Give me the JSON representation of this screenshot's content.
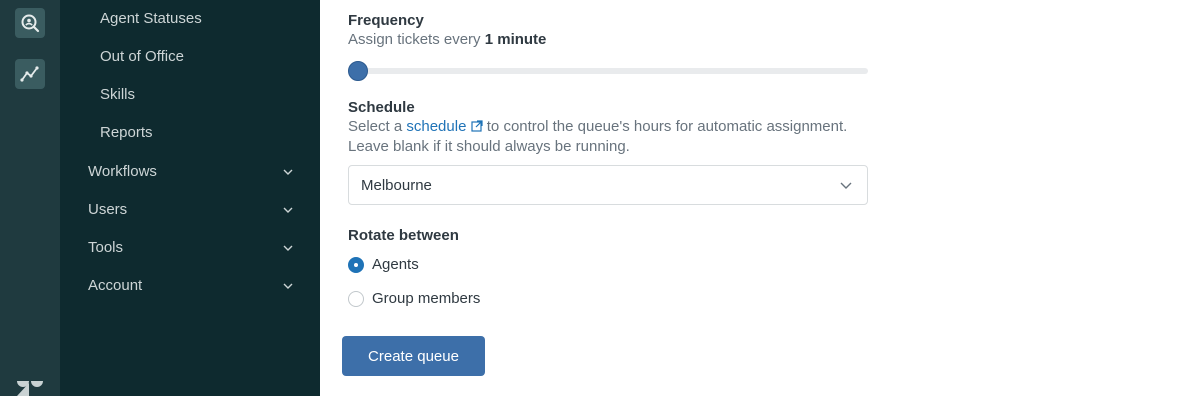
{
  "rail": {
    "icons": [
      "search-user-icon",
      "analytics-icon",
      "zendesk-logo-icon"
    ]
  },
  "sidebar": {
    "sub_items": [
      "Agent Statuses",
      "Out of Office",
      "Skills",
      "Reports"
    ],
    "sections": [
      "Workflows",
      "Users",
      "Tools",
      "Account"
    ]
  },
  "form": {
    "frequency": {
      "label": "Frequency",
      "hint_prefix": "Assign tickets every ",
      "hint_value": "1 minute",
      "slider_fraction": 0
    },
    "schedule": {
      "label": "Schedule",
      "hint_before": "Select a ",
      "hint_link": "schedule",
      "hint_after": " to control the queue's hours for automatic assignment.",
      "hint_line2": "Leave blank if it should always be running.",
      "selected": "Melbourne"
    },
    "rotate": {
      "label": "Rotate between",
      "options": [
        {
          "label": "Agents",
          "checked": true
        },
        {
          "label": "Group members",
          "checked": false
        }
      ]
    },
    "submit_label": "Create queue"
  },
  "colors": {
    "rail": "#1f3a3f",
    "sidebar": "#0e2a2f",
    "primary": "#3d6fa9",
    "link": "#1f73b7"
  }
}
